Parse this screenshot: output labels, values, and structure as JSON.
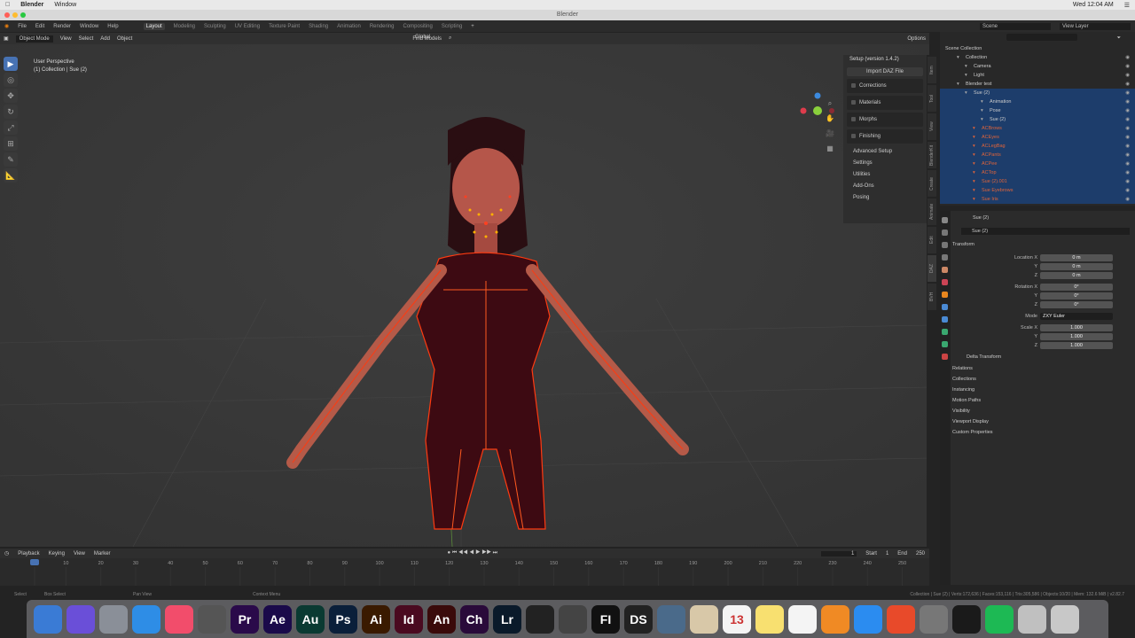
{
  "mac_menu": {
    "app": "Blender",
    "window": "Window",
    "clock": "Wed 12:04 AM"
  },
  "window_title": "Blender",
  "top_menu": [
    "File",
    "Edit",
    "Render",
    "Window",
    "Help"
  ],
  "workspaces": [
    "Layout",
    "Modeling",
    "Sculpting",
    "UV Editing",
    "Texture Paint",
    "Shading",
    "Animation",
    "Rendering",
    "Compositing",
    "Scripting"
  ],
  "top_right": {
    "scene_label": "Scene",
    "viewlayer_label": "View Layer"
  },
  "viewport_header": {
    "mode": "Object Mode",
    "menus": [
      "View",
      "Select",
      "Add",
      "Object"
    ],
    "transform": "Global",
    "find_models": "Find Models",
    "options": "Options"
  },
  "viewport_overlay": {
    "line1": "User Perspective",
    "line2": "(1) Collection | Sue (2)"
  },
  "npanel": {
    "title": "Setup (version 1.4.2)",
    "import_btn": "Import DAZ File",
    "boxes": [
      "Corrections",
      "Materials",
      "Morphs",
      "Finishing"
    ],
    "items": [
      "Advanced Setup",
      "Settings",
      "Utilities",
      "Add-Ons",
      "Posing"
    ]
  },
  "side_tabs": [
    "Item",
    "Tool",
    "View",
    "BlenderKit",
    "Create",
    "Animate",
    "Edit",
    "DAZ",
    "BVH"
  ],
  "outliner": {
    "root": "Scene Collection",
    "rows": [
      {
        "name": "Collection",
        "indent": 1
      },
      {
        "name": "Camera",
        "indent": 2
      },
      {
        "name": "Light",
        "indent": 2
      },
      {
        "name": "Blender test",
        "indent": 1
      },
      {
        "name": "Sue (2)",
        "indent": 2,
        "sel": true
      },
      {
        "name": "Animation",
        "indent": 4,
        "sel": true
      },
      {
        "name": "Pose",
        "indent": 4,
        "sel": true
      },
      {
        "name": "Sue (2)",
        "indent": 4,
        "sel": true
      },
      {
        "name": "ACBrows",
        "indent": 3,
        "sel": true,
        "red": true
      },
      {
        "name": "ACEyes",
        "indent": 3,
        "sel": true,
        "red": true
      },
      {
        "name": "ACLegBag",
        "indent": 3,
        "sel": true,
        "red": true
      },
      {
        "name": "ACPants",
        "indent": 3,
        "sel": true,
        "red": true
      },
      {
        "name": "ACPee",
        "indent": 3,
        "sel": true,
        "red": true
      },
      {
        "name": "ACTop",
        "indent": 3,
        "sel": true,
        "red": true
      },
      {
        "name": "Sue (2).001",
        "indent": 3,
        "sel": true,
        "red": true
      },
      {
        "name": "Sue Eyebrows",
        "indent": 3,
        "sel": true,
        "red": true
      },
      {
        "name": "Sue Iris",
        "indent": 3,
        "sel": true,
        "red": true
      }
    ]
  },
  "properties": {
    "object_name": "Sue (2)",
    "object_field": "Sue (2)",
    "transform_label": "Transform",
    "location": [
      {
        "label": "Location X",
        "value": "0 m"
      },
      {
        "label": "Y",
        "value": "0 m"
      },
      {
        "label": "Z",
        "value": "0 m"
      }
    ],
    "rotation": [
      {
        "label": "Rotation X",
        "value": "0°"
      },
      {
        "label": "Y",
        "value": "0°"
      },
      {
        "label": "Z",
        "value": "0°"
      }
    ],
    "mode_label": "Mode",
    "mode_value": "ZXY Euler",
    "scale": [
      {
        "label": "Scale X",
        "value": "1.000"
      },
      {
        "label": "Y",
        "value": "1.000"
      },
      {
        "label": "Z",
        "value": "1.000"
      }
    ],
    "delta": "Delta Transform",
    "sections": [
      "Relations",
      "Collections",
      "Instancing",
      "Motion Paths",
      "Visibility",
      "Viewport Display",
      "Custom Properties"
    ]
  },
  "timeline": {
    "menus": [
      "Playback",
      "Keying",
      "View",
      "Marker"
    ],
    "current_frame": "1",
    "start_label": "Start",
    "start": "1",
    "end_label": "End",
    "end": "250",
    "ticks": [
      "1",
      "10",
      "20",
      "30",
      "40",
      "50",
      "60",
      "70",
      "80",
      "90",
      "100",
      "110",
      "120",
      "130",
      "140",
      "150",
      "160",
      "170",
      "180",
      "190",
      "200",
      "210",
      "220",
      "230",
      "240",
      "250"
    ]
  },
  "status": {
    "left1": "Select",
    "left2": "Box Select",
    "mid1": "Pan View",
    "mid2": "Context Menu",
    "right": "Collection | Sue (2) | Verts:172,636 | Faces:153,116 | Tris:305,586 | Objects:10/20 | Mem: 132.6 MiB | v2.82.7"
  },
  "dock": [
    {
      "label": "",
      "color": "#3a7bd5",
      "icon": "finder-icon"
    },
    {
      "label": "",
      "color": "#6a4fd8",
      "icon": "siri-icon"
    },
    {
      "label": "",
      "color": "#8a8f98",
      "icon": "launchpad-icon"
    },
    {
      "label": "",
      "color": "#2e8de6",
      "icon": "safari-icon"
    },
    {
      "label": "",
      "color": "#f24d6b",
      "icon": "music-icon"
    },
    {
      "label": "",
      "color": "#555",
      "icon": "final-cut-icon"
    },
    {
      "label": "Pr",
      "color": "#2a0a4a",
      "icon": "premiere-icon"
    },
    {
      "label": "Ae",
      "color": "#1a0a4a",
      "icon": "after-effects-icon"
    },
    {
      "label": "Au",
      "color": "#0a3a32",
      "icon": "audition-icon"
    },
    {
      "label": "Ps",
      "color": "#0a1f3a",
      "icon": "photoshop-icon"
    },
    {
      "label": "Ai",
      "color": "#3a1a00",
      "icon": "illustrator-icon"
    },
    {
      "label": "Id",
      "color": "#4a0a20",
      "icon": "indesign-icon"
    },
    {
      "label": "An",
      "color": "#3a0a0a",
      "icon": "animate-icon"
    },
    {
      "label": "Ch",
      "color": "#2a0a3a",
      "icon": "character-animator-icon"
    },
    {
      "label": "Lr",
      "color": "#0a1a2a",
      "icon": "lightroom-icon"
    },
    {
      "label": "",
      "color": "#222",
      "icon": "davinci-icon"
    },
    {
      "label": "",
      "color": "#444",
      "icon": "blender-icon"
    },
    {
      "label": "FI",
      "color": "#111",
      "icon": "fi-icon"
    },
    {
      "label": "DS",
      "color": "#222",
      "icon": "daz-studio-icon"
    },
    {
      "label": "",
      "color": "#4a6a8a",
      "icon": "cube-icon"
    },
    {
      "label": "",
      "color": "#d8c8a8",
      "icon": "preview-icon"
    },
    {
      "label": "13",
      "color": "#f4f4f4",
      "icon": "calendar-icon"
    },
    {
      "label": "",
      "color": "#f8e070",
      "icon": "notes-icon"
    },
    {
      "label": "",
      "color": "#f4f4f4",
      "icon": "photos-icon"
    },
    {
      "label": "",
      "color": "#f08a24",
      "icon": "books-icon"
    },
    {
      "label": "",
      "color": "#2b8cf0",
      "icon": "app-store-icon"
    },
    {
      "label": "",
      "color": "#e84a2a",
      "icon": "toolbox-icon"
    },
    {
      "label": "",
      "color": "#777",
      "icon": "system-preferences-icon"
    },
    {
      "label": "",
      "color": "#1a1a1a",
      "icon": "quicktime-icon"
    },
    {
      "label": "",
      "color": "#1db954",
      "icon": "spotify-icon"
    },
    {
      "label": "",
      "color": "#c0c0c0",
      "icon": "folder-icon"
    },
    {
      "label": "",
      "color": "#c8c8c8",
      "icon": "trash-icon"
    }
  ]
}
